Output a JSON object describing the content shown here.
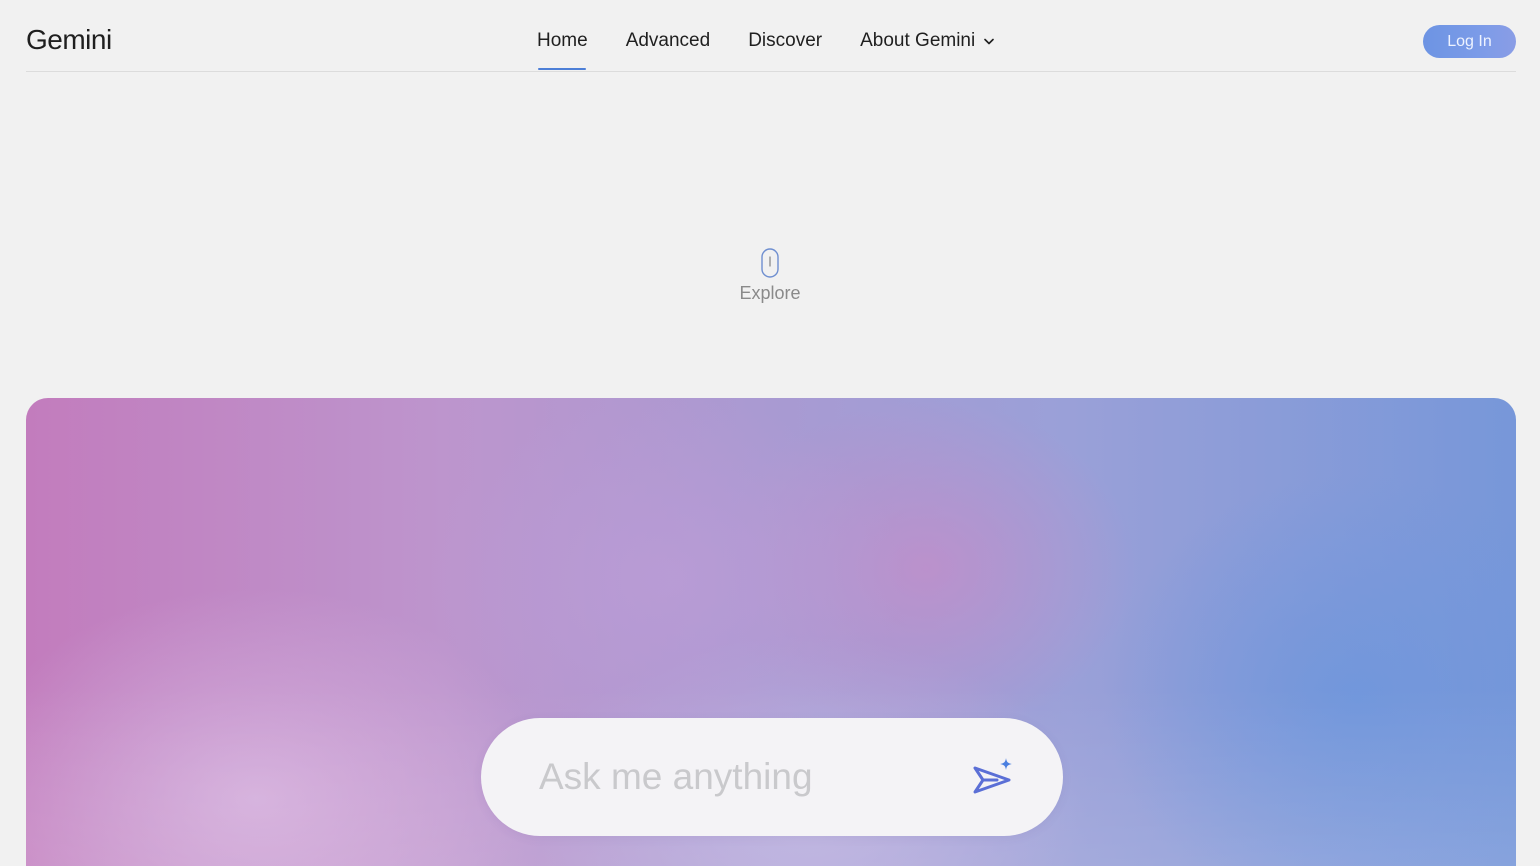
{
  "header": {
    "logo": "Gemini",
    "nav": [
      {
        "label": "Home",
        "active": true
      },
      {
        "label": "Advanced",
        "active": false
      },
      {
        "label": "Discover",
        "active": false
      },
      {
        "label": "About Gemini",
        "active": false,
        "has_dropdown": true
      }
    ],
    "login_label": "Log In"
  },
  "explore": {
    "label": "Explore",
    "icon": "mouse-scroll-icon"
  },
  "hero": {
    "ask_placeholder": "Ask me anything",
    "ask_value": "",
    "send_icon": "sparkle-send-icon"
  },
  "colors": {
    "accent": "#4d7fd7",
    "login_button": "#7b9be8",
    "background": "#f1f1f1",
    "send_icon": "#5b6fd6",
    "sparkle": "#4a7fe0"
  }
}
